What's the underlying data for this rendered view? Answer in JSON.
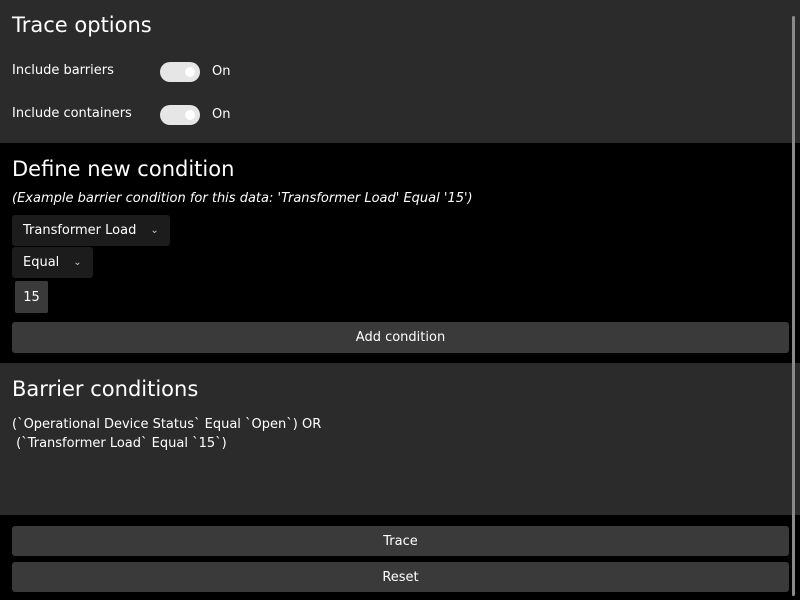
{
  "trace_options": {
    "title": "Trace options",
    "include_barriers": {
      "label": "Include barriers",
      "state": "On",
      "on": true
    },
    "include_containers": {
      "label": "Include containers",
      "state": "On",
      "on": true
    }
  },
  "define_condition": {
    "title": "Define new condition",
    "hint": "(Example barrier condition for this data: 'Transformer Load' Equal '15')",
    "attribute": "Transformer Load",
    "operator": "Equal",
    "value": "15",
    "add_label": "Add condition"
  },
  "barrier_conditions": {
    "title": "Barrier conditions",
    "line1": "(`Operational Device Status` Equal `Open`) OR",
    "line2": " (`Transformer Load` Equal `15`)"
  },
  "actions": {
    "trace": "Trace",
    "reset": "Reset"
  }
}
